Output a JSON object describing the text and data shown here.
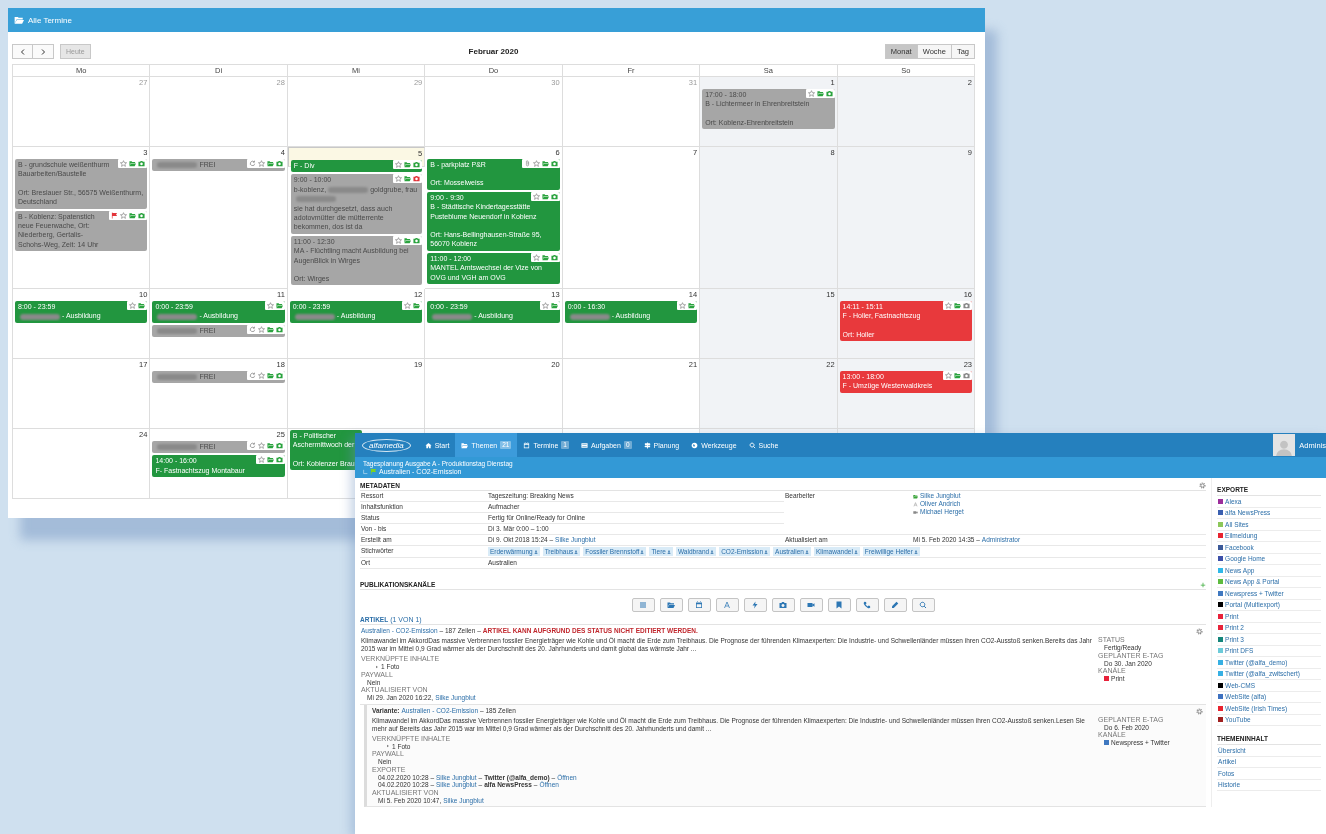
{
  "calendar": {
    "title": "Alle Termine",
    "today_button": "Heute",
    "today_disabled": true,
    "month": "Februar 2020",
    "views": [
      {
        "label": "Monat",
        "selected": true
      },
      {
        "label": "Woche",
        "selected": false
      },
      {
        "label": "Tag",
        "selected": false
      }
    ],
    "weekdays": [
      "Mo",
      "Di",
      "Mi",
      "Do",
      "Fr",
      "Sa",
      "So"
    ],
    "weeks": [
      [
        {
          "num": "27",
          "other_month": true,
          "today": false
        },
        {
          "num": "28",
          "other_month": true,
          "today": false
        },
        {
          "num": "29",
          "other_month": true,
          "today": false
        },
        {
          "num": "30",
          "other_month": true,
          "today": false
        },
        {
          "num": "31",
          "other_month": true,
          "today": false
        },
        {
          "num": "1",
          "other_month": false,
          "today": false,
          "events": [
            {
              "color": "#a6a6a6",
              "time": "17:00 - 18:00",
              "title": [
                {
                  "kind": "text",
                  "text": "B - Lichtermeer in Ehrenbreitstein"
                }
              ],
              "place": "Ort: Koblenz-Ehrenbreitstein",
              "icons": [
                {
                  "kind": "star"
                },
                {
                  "kind": "folder"
                },
                {
                  "kind": "camera"
                }
              ]
            }
          ]
        },
        {
          "num": "2",
          "other_month": false,
          "today": false
        }
      ],
      [
        {
          "num": "3",
          "other_month": false,
          "today": false,
          "events": [
            {
              "color": "#a6a6a6",
              "title": [
                {
                  "kind": "text",
                  "text": "B - grundschule weißenthurm Bauarbeiten/Baustelle"
                }
              ],
              "place": "Ort: Breslauer Str., 56575 Weißenthurm, Deutschland",
              "icons": [
                {
                  "kind": "star"
                },
                {
                  "kind": "folder"
                },
                {
                  "kind": "camera"
                }
              ]
            },
            {
              "color": "#a6a6a6",
              "title": [
                {
                  "kind": "text",
                  "text": "B - Koblenz: Spatenstich neue Feuerwache, Ort: Niederberg, Gertalis-Schohs-Weg, Zeit: 14 Uhr"
                }
              ],
              "icons": [
                {
                  "kind": "flag"
                },
                {
                  "kind": "star"
                },
                {
                  "kind": "folder"
                },
                {
                  "kind": "camera"
                }
              ]
            }
          ]
        },
        {
          "num": "4",
          "other_month": false,
          "today": false,
          "events": [
            {
              "color": "#a6a6a6",
              "title": [
                {
                  "kind": "blur"
                },
                {
                  "kind": "text",
                  "text": "FREI"
                }
              ],
              "icons": [
                {
                  "kind": "refresh"
                },
                {
                  "kind": "star"
                },
                {
                  "kind": "folder"
                },
                {
                  "kind": "camera"
                }
              ]
            }
          ]
        },
        {
          "num": "5",
          "other_month": false,
          "today": true,
          "events": [
            {
              "color": "#22963f",
              "title": [
                {
                  "kind": "text",
                  "text": "F - Div"
                }
              ],
              "icons": [
                {
                  "kind": "star"
                },
                {
                  "kind": "folder"
                },
                {
                  "kind": "camera"
                }
              ]
            },
            {
              "color": "#a6a6a6",
              "time": "9:00 - 10:00",
              "title": [
                {
                  "kind": "text",
                  "text": "b-koblenz,"
                },
                {
                  "kind": "blur"
                },
                {
                  "kind": "text",
                  "text": "goldgrube, frau"
                },
                {
                  "kind": "blur"
                },
                {
                  "kind": "text",
                  "text": "sie hat durchgesetzt, dass auch adotovmütter die mütterrente bekommen, dos ist da"
                }
              ],
              "icons": [
                {
                  "kind": "star"
                },
                {
                  "kind": "folder"
                },
                {
                  "kind": "camera-red"
                }
              ]
            },
            {
              "color": "#a6a6a6",
              "time": "11:00 - 12:30",
              "title": [
                {
                  "kind": "text",
                  "text": "MA - Flüchtling macht Ausbildung bei AugenBlick in Wirges"
                }
              ],
              "place": "Ort: Wirges",
              "icons": [
                {
                  "kind": "star"
                },
                {
                  "kind": "folder"
                },
                {
                  "kind": "camera"
                }
              ]
            }
          ]
        },
        {
          "num": "6",
          "other_month": false,
          "today": false,
          "events": [
            {
              "color": "#22963f",
              "title": [
                {
                  "kind": "text",
                  "text": "B - parkplatz P&R"
                }
              ],
              "place": "Ort: Mosselweiss",
              "icons": [
                {
                  "kind": "clip"
                },
                {
                  "kind": "star"
                },
                {
                  "kind": "folder"
                },
                {
                  "kind": "camera"
                }
              ]
            },
            {
              "color": "#22963f",
              "time": "9:00 - 9:30",
              "title": [
                {
                  "kind": "text",
                  "text": "B - Städtische Kindertagesstätte Pusteblume Neuendorf in Koblenz"
                }
              ],
              "place": "Ort: Hans-Bellinghausen-Straße 95, 56070 Koblenz",
              "icons": [
                {
                  "kind": "star"
                },
                {
                  "kind": "folder"
                },
                {
                  "kind": "camera"
                }
              ]
            },
            {
              "color": "#22963f",
              "time": "11:00 - 12:00",
              "title": [
                {
                  "kind": "text",
                  "text": "MANTEL Amtswechsel der Vize von OVG und VGH am OVG"
                }
              ],
              "icons": [
                {
                  "kind": "star"
                },
                {
                  "kind": "folder"
                },
                {
                  "kind": "camera"
                }
              ]
            }
          ]
        },
        {
          "num": "7",
          "other_month": false,
          "today": false
        },
        {
          "num": "8",
          "other_month": false,
          "today": false
        },
        {
          "num": "9",
          "other_month": false,
          "today": false
        }
      ],
      [
        {
          "num": "10",
          "other_month": false,
          "today": false,
          "events": [
            {
              "color": "#22963f",
              "time": "8:00 - 23:59",
              "title": [
                {
                  "kind": "blur"
                },
                {
                  "kind": "text",
                  "text": "- Ausbildung"
                }
              ],
              "icons": [
                {
                  "kind": "star"
                },
                {
                  "kind": "folder"
                }
              ]
            }
          ]
        },
        {
          "num": "11",
          "other_month": false,
          "today": false,
          "events": [
            {
              "color": "#22963f",
              "time": "0:00 - 23:59",
              "title": [
                {
                  "kind": "blur"
                },
                {
                  "kind": "text",
                  "text": "- Ausbildung"
                }
              ],
              "icons": [
                {
                  "kind": "star"
                },
                {
                  "kind": "folder"
                }
              ]
            },
            {
              "color": "#a6a6a6",
              "title": [
                {
                  "kind": "blur"
                },
                {
                  "kind": "text",
                  "text": "FREI"
                }
              ],
              "icons": [
                {
                  "kind": "refresh"
                },
                {
                  "kind": "star"
                },
                {
                  "kind": "folder"
                },
                {
                  "kind": "camera"
                }
              ]
            }
          ]
        },
        {
          "num": "12",
          "other_month": false,
          "today": false,
          "events": [
            {
              "color": "#22963f",
              "time": "0:00 - 23:59",
              "title": [
                {
                  "kind": "blur"
                },
                {
                  "kind": "text",
                  "text": "- Ausbildung"
                }
              ],
              "icons": [
                {
                  "kind": "star"
                },
                {
                  "kind": "folder"
                }
              ]
            }
          ]
        },
        {
          "num": "13",
          "other_month": false,
          "today": false,
          "events": [
            {
              "color": "#22963f",
              "time": "0:00 - 23:59",
              "title": [
                {
                  "kind": "blur"
                },
                {
                  "kind": "text",
                  "text": "- Ausbildung"
                }
              ],
              "icons": [
                {
                  "kind": "star"
                },
                {
                  "kind": "folder"
                }
              ]
            }
          ]
        },
        {
          "num": "14",
          "other_month": false,
          "today": false,
          "events": [
            {
              "color": "#22963f",
              "time": "0:00 - 16:30",
              "title": [
                {
                  "kind": "blur"
                },
                {
                  "kind": "text",
                  "text": "- Ausbildung"
                }
              ],
              "icons": [
                {
                  "kind": "star"
                },
                {
                  "kind": "folder"
                }
              ]
            }
          ]
        },
        {
          "num": "15",
          "other_month": false,
          "today": false
        },
        {
          "num": "16",
          "other_month": false,
          "today": false,
          "events": [
            {
              "color": "#e8393c",
              "time": "14:11 - 15:11",
              "title": [
                {
                  "kind": "text",
                  "text": "F - Holler, Fastnachtszug"
                }
              ],
              "place": "Ort: Holler",
              "icons": [
                {
                  "kind": "star"
                },
                {
                  "kind": "folder"
                },
                {
                  "kind": "camera-grey"
                }
              ]
            }
          ]
        }
      ],
      [
        {
          "num": "17",
          "other_month": false,
          "today": false
        },
        {
          "num": "18",
          "other_month": false,
          "today": false,
          "events": [
            {
              "color": "#a6a6a6",
              "title": [
                {
                  "kind": "blur"
                },
                {
                  "kind": "text",
                  "text": "FREI"
                }
              ],
              "icons": [
                {
                  "kind": "refresh"
                },
                {
                  "kind": "star"
                },
                {
                  "kind": "folder"
                },
                {
                  "kind": "camera"
                }
              ]
            }
          ]
        },
        {
          "num": "19",
          "other_month": false,
          "today": false
        },
        {
          "num": "20",
          "other_month": false,
          "today": false
        },
        {
          "num": "21",
          "other_month": false,
          "today": false
        },
        {
          "num": "22",
          "other_month": false,
          "today": false
        },
        {
          "num": "23",
          "other_month": false,
          "today": false,
          "events": [
            {
              "color": "#e8393c",
              "time": "13:00 - 18:00",
              "title": [
                {
                  "kind": "text",
                  "text": "F - Umzüge Westerwaldkreis"
                }
              ],
              "icons": [
                {
                  "kind": "star"
                },
                {
                  "kind": "folder"
                },
                {
                  "kind": "camera-grey"
                }
              ]
            }
          ]
        }
      ],
      [
        {
          "num": "24",
          "other_month": false,
          "today": false
        },
        {
          "num": "25",
          "other_month": false,
          "today": false,
          "events": [
            {
              "color": "#a6a6a6",
              "title": [
                {
                  "kind": "blur"
                },
                {
                  "kind": "text",
                  "text": "FREI"
                }
              ],
              "icons": [
                {
                  "kind": "refresh"
                },
                {
                  "kind": "star"
                },
                {
                  "kind": "folder"
                },
                {
                  "kind": "camera"
                }
              ]
            },
            {
              "color": "#22963f",
              "time": "14:00 - 16:00",
              "title": [
                {
                  "kind": "text",
                  "text": "F- Fastnachtszug Montabaur"
                }
              ],
              "icons": [
                {
                  "kind": "star"
                },
                {
                  "kind": "folder"
                },
                {
                  "kind": "camera"
                }
              ]
            }
          ]
        },
        {
          "today": false,
          "events": [
            {
              "color": "#22963f",
              "title": [
                {
                  "kind": "text",
                  "text": "B - Politischer Aschermittwoch der"
                }
              ],
              "place": "Ort: Koblenzer Brau"
            }
          ]
        },
        {
          "today": false
        },
        {
          "today": false
        },
        {
          "today": false
        },
        {
          "today": false
        }
      ]
    ]
  },
  "editor": {
    "logo": "alfamedia",
    "nav": [
      {
        "label": "Start",
        "selected": false
      },
      {
        "label": "Themen",
        "count": "21",
        "selected": true
      },
      {
        "label": "Termine",
        "count": "1",
        "selected": false
      },
      {
        "label": "Aufgaben",
        "count": "0",
        "selected": false
      },
      {
        "label": "Planung",
        "selected": false
      },
      {
        "label": "Werkzeuge",
        "selected": false
      },
      {
        "label": "Suche",
        "selected": false
      }
    ],
    "user": "Adminis",
    "breadcrumb": "Tagesplanung Ausgabe A - Produktionstag Dienstag",
    "topic": "Australien - CO2-Emission",
    "metadata": {
      "title": "METADATEN",
      "rows": [
        {
          "label": "Ressort",
          "value": "Tageszeitung: Breaking News"
        },
        {
          "label": "Inhaltsfunktion",
          "value": "Aufmacher"
        },
        {
          "label": "Status",
          "value": "Fertig für Online/Ready for Online"
        },
        {
          "label": "Von - bis",
          "value": "Di 3. Mär 0:00 – 1:00"
        }
      ],
      "editors_label": "Bearbeiter",
      "editors": [
        "Silke Jungblut",
        "Oliver Andrich",
        "Michael Herget"
      ],
      "created_label": "Erstellt am",
      "created": [
        {
          "kind": "text",
          "text": "Di 9. Okt 2018 15:24 –"
        },
        {
          "kind": "link",
          "text": "Silke Jungblut"
        }
      ],
      "updated_label": "Aktualisiert am",
      "updated": [
        {
          "kind": "text",
          "text": "Mi 5. Feb 2020 14:35 –"
        },
        {
          "kind": "link",
          "text": "Administrator"
        }
      ],
      "keywords_label": "Stichwörter",
      "keywords": [
        "Erderwärmung",
        "Treibhaus",
        "Fossiler Brennstoff",
        "Tiere",
        "Waldbrand",
        "CO2-Emission",
        "Australien",
        "Klimawandel",
        "Freiwillige Helfer"
      ],
      "place_label": "Ort",
      "place": "Australien"
    },
    "channels_title": "PUBLIKATIONSKANÄLE",
    "toolbar": [
      {
        "kind": "list"
      },
      {
        "kind": "folder"
      },
      {
        "kind": "calendar"
      },
      {
        "kind": "font"
      },
      {
        "kind": "bolt"
      },
      {
        "kind": "camera"
      },
      {
        "kind": "video"
      },
      {
        "kind": "bookmark"
      },
      {
        "kind": "phone"
      },
      {
        "kind": "pencil"
      },
      {
        "kind": "search"
      }
    ],
    "articles_title": "ARTIKEL",
    "articles_count": "(1 VON 1)",
    "articles": [
      {
        "kind": "article",
        "header": [
          {
            "kind": "link",
            "text": "Australien - CO2-Emission"
          },
          {
            "kind": "text",
            "text": "– 187 Zeilen –"
          },
          {
            "kind": "alert",
            "text": "ARTIKEL KANN AUFGRUND DES STATUS NICHT EDITIERT WERDEN."
          }
        ],
        "body": "Klimawandel im AkkordDas massive Verbrennen fossiler Energieträger wie Kohle und Öl macht die Erde zum Treibhaus. Die Prognose der führenden Klimaexperten: Die Industrie- und Schwellenländer müssen ihren CO2-Ausstoß senken.Bereits das Jahr 2015 war im Mittel 0,9 Grad wärmer als der Durchschnitt des 20. Jahrhunderts und damit global das wärmste Jahr ...",
        "fields": [
          {
            "label": "VERKNÜPFTE INHALTE",
            "kind": "expander",
            "lines": [
              [
                {
                  "kind": "text",
                  "text": "1 Foto"
                }
              ]
            ]
          },
          {
            "label": "PAYWALL",
            "kind": "plain",
            "lines": [
              [
                {
                  "kind": "text",
                  "text": "Nein"
                }
              ]
            ]
          },
          {
            "label": "AKTUALISIERT VON",
            "kind": "plain",
            "lines": [
              [
                {
                  "kind": "text",
                  "text": "Mi 29. Jan 2020 16:22,"
                },
                {
                  "kind": "link",
                  "text": "Silke Jungblut"
                }
              ]
            ]
          }
        ],
        "side": [
          {
            "label": "STATUS",
            "value": "Fertig/Ready"
          },
          {
            "label": "GEPLANTER E-TAG",
            "value": "Do 30. Jan 2020"
          },
          {
            "label": "KANÄLE",
            "value": "Print",
            "color": "#e8213a"
          }
        ]
      },
      {
        "kind": "variant",
        "header": [
          {
            "kind": "bold",
            "text": "Variante:"
          },
          {
            "kind": "link",
            "text": "Australien - CO2-Emission"
          },
          {
            "kind": "text",
            "text": "– 185 Zeilen"
          }
        ],
        "body": "Klimawandel im AkkordDas massive Verbrennen fossiler Energieträger wie Kohle und Öl macht die Erde zum Treibhaus. Die Prognose der führenden Klimaexperten: Die Industrie- und Schwellenländer müssen ihren CO2-Ausstoß senken.Lesen Sie mehr auf Bereits das Jahr 2015 war im Mittel 0,9 Grad wärmer als der Durchschnitt des 20. Jahrhunderts und damit ...",
        "fields": [
          {
            "label": "VERKNÜPFTE INHALTE",
            "kind": "expander",
            "lines": [
              [
                {
                  "kind": "text",
                  "text": "1 Foto"
                }
              ]
            ]
          },
          {
            "label": "PAYWALL",
            "kind": "plain",
            "lines": [
              [
                {
                  "kind": "text",
                  "text": "Nein"
                }
              ]
            ]
          },
          {
            "label": "EXPORTE",
            "kind": "plain",
            "lines": [
              [
                {
                  "kind": "text",
                  "text": "04.02.2020 10:28 –"
                },
                {
                  "kind": "link",
                  "text": "Silke Jungblut"
                },
                {
                  "kind": "text",
                  "text": "–"
                },
                {
                  "kind": "bold",
                  "text": "Twitter (@alfa_demo)"
                },
                {
                  "kind": "text",
                  "text": "–"
                },
                {
                  "kind": "link",
                  "text": "Öffnen"
                }
              ],
              [
                {
                  "kind": "text",
                  "text": "04.02.2020 10:28 –"
                },
                {
                  "kind": "link",
                  "text": "Silke Jungblut"
                },
                {
                  "kind": "text",
                  "text": "–"
                },
                {
                  "kind": "bold",
                  "text": "alfa NewsPress"
                },
                {
                  "kind": "text",
                  "text": "–"
                },
                {
                  "kind": "link",
                  "text": "Öffnen"
                }
              ]
            ]
          },
          {
            "label": "AKTUALISIERT VON",
            "kind": "plain",
            "lines": [
              [
                {
                  "kind": "text",
                  "text": "Mi 5. Feb 2020 10:47,"
                },
                {
                  "kind": "link",
                  "text": "Silke Jungblut"
                }
              ]
            ]
          }
        ],
        "side": [
          {
            "label": "GEPLANTER E-TAG",
            "value": "Do 6. Feb 2020"
          },
          {
            "label": "KANÄLE",
            "value": "Newspress + Twitter",
            "color": "#3f78c0"
          }
        ]
      }
    ],
    "exports": {
      "title": "EXPORTE",
      "items": [
        {
          "name": "Alexa",
          "color": "#9b2d9b"
        },
        {
          "name": "alfa NewsPress",
          "color": "#3a5fb0"
        },
        {
          "name": "All Sites",
          "color": "#8cc75a"
        },
        {
          "name": "Eilmeldung",
          "color": "#e8232f"
        },
        {
          "name": "Facebook",
          "color": "#3b5998"
        },
        {
          "name": "Google Home",
          "color": "#3c4fa8"
        },
        {
          "name": "News App",
          "color": "#2fb8e8"
        },
        {
          "name": "News App & Portal",
          "color": "#5dbb3f"
        },
        {
          "name": "Newspress + Twitter",
          "color": "#3f78c0"
        },
        {
          "name": "Portal (Multiexport)",
          "color": "#000000"
        },
        {
          "name": "Print",
          "color": "#e8213a"
        },
        {
          "name": "Print 2",
          "color": "#e8233a"
        },
        {
          "name": "Print 3",
          "color": "#14857a"
        },
        {
          "name": "Print DFS",
          "color": "#6ccbd9"
        },
        {
          "name": "Twitter (@alfa_demo)",
          "color": "#36b0e3"
        },
        {
          "name": "Twitter (@alfa_zwitschert)",
          "color": "#36b0e4"
        },
        {
          "name": "Web-CMS",
          "color": "#000000"
        },
        {
          "name": "WebSite (alfa)",
          "color": "#3d71c0"
        },
        {
          "name": "WebSite (Irish Times)",
          "color": "#e8232f"
        },
        {
          "name": "YouTube",
          "color": "#a02020"
        }
      ]
    },
    "contents": {
      "title": "THEMENINHALT",
      "items": [
        "Übersicht",
        "Artikel",
        "Fotos",
        "Historie"
      ]
    }
  }
}
